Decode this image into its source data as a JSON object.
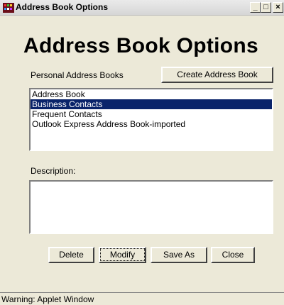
{
  "window": {
    "title": "Address Book Options",
    "controls": {
      "minimize": "_",
      "maximize": "□",
      "close": "×"
    }
  },
  "heading": "Address Book Options",
  "address_books": {
    "label": "Personal Address Books",
    "create_button": "Create Address Book",
    "items": [
      "Address Book",
      "Business Contacts",
      "Frequent Contacts",
      "Outlook Express Address Book-imported"
    ],
    "selected_index": 1
  },
  "description": {
    "label": "Description:",
    "value": ""
  },
  "buttons": {
    "delete": "Delete",
    "modify": "Modify",
    "save_as": "Save As",
    "close": "Close"
  },
  "status": "Warning: Applet Window",
  "colors": {
    "selection": "#0a246a",
    "background": "#ece9d8"
  }
}
